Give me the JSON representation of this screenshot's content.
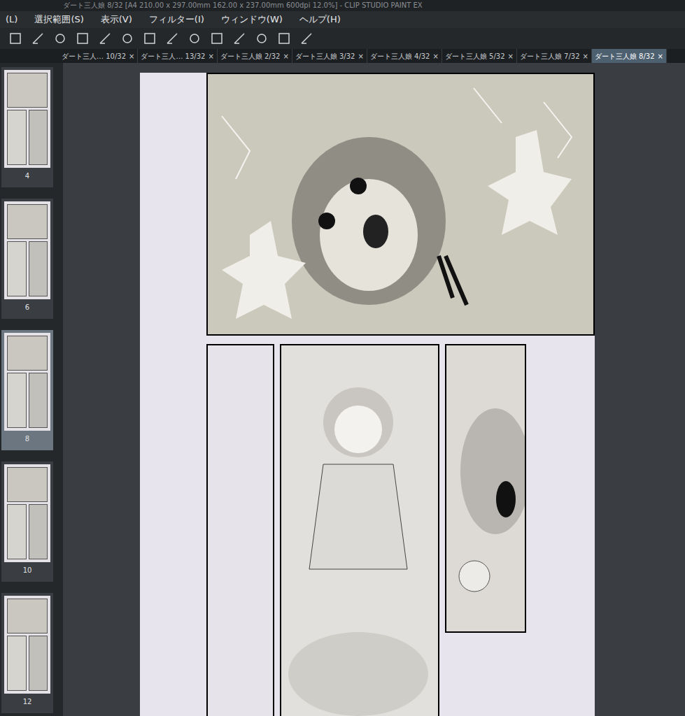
{
  "window": {
    "title": "ダート三人娘 8/32 [A4 210.00 x 297.00mm 162.00 x 237.00mm 600dpi 12.0%] - CLIP STUDIO PAINT EX"
  },
  "menu": [
    "(L)",
    "選択範囲(S)",
    "表示(V)",
    "フィルター(I)",
    "ウィンドウ(W)",
    "ヘルプ(H)"
  ],
  "tabs": [
    {
      "label": "ダート三人… 10/32",
      "selected": false,
      "close": "×"
    },
    {
      "label": "ダート三人… 13/32",
      "selected": false,
      "close": "×"
    },
    {
      "label": "ダート三人娘 2/32",
      "selected": false,
      "close": "×"
    },
    {
      "label": "ダート三人娘 3/32",
      "selected": false,
      "close": "×"
    },
    {
      "label": "ダート三人娘 4/32",
      "selected": false,
      "close": "×"
    },
    {
      "label": "ダート三人娘 5/32",
      "selected": false,
      "close": "×"
    },
    {
      "label": "ダート三人娘 7/32",
      "selected": false,
      "close": "×"
    },
    {
      "label": "ダート三人娘 8/32",
      "selected": true,
      "close": "×"
    }
  ],
  "pages": [
    {
      "number": "4",
      "selected": false
    },
    {
      "number": "6",
      "selected": false
    },
    {
      "number": "8",
      "selected": true
    },
    {
      "number": "10",
      "selected": false
    },
    {
      "number": "12",
      "selected": false
    }
  ]
}
